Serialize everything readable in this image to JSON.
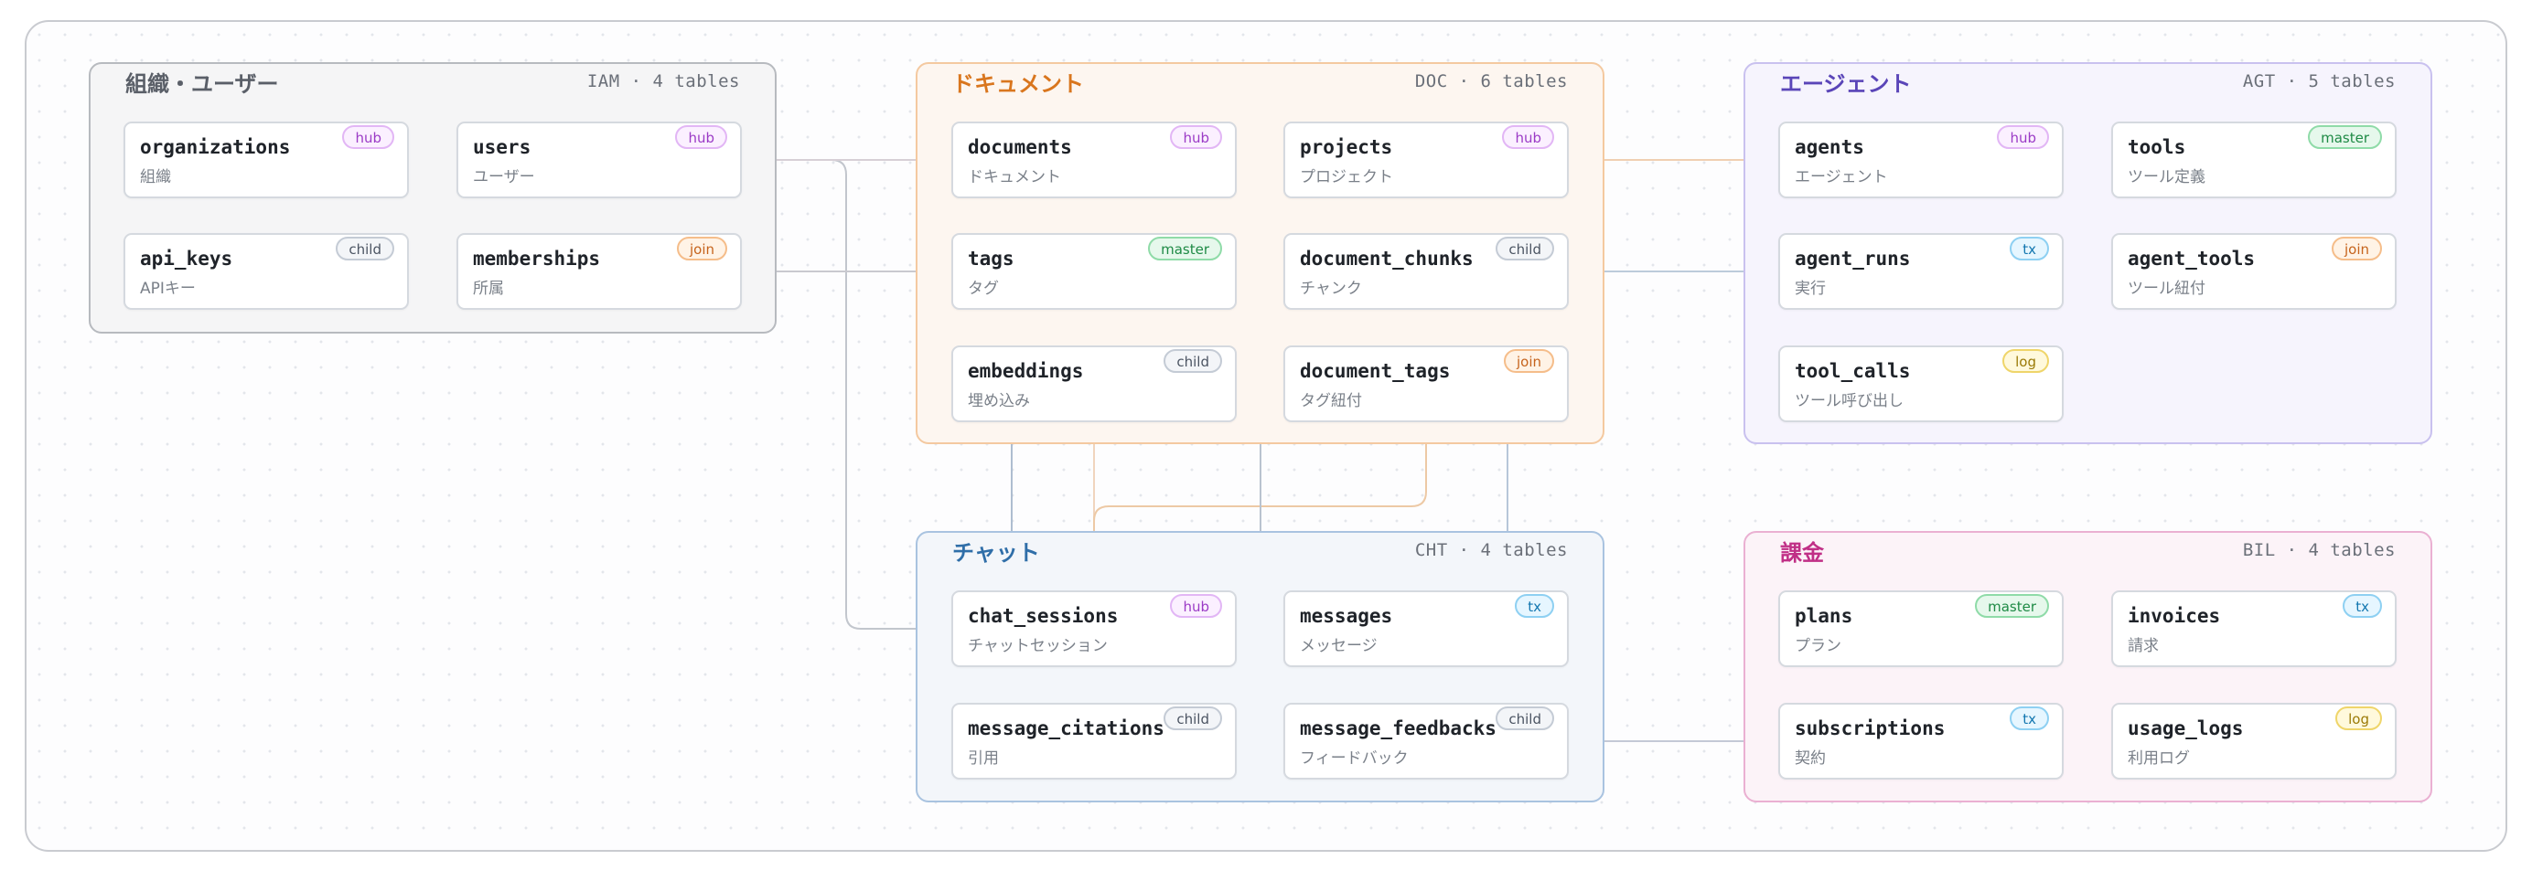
{
  "groups": [
    {
      "id": "iam",
      "title": "組織・ユーザー",
      "meta": "IAM · 4 tables",
      "color": "#5a5f68",
      "border": "#b7babf",
      "bg": "#f5f5f6"
    },
    {
      "id": "doc",
      "title": "ドキュメント",
      "meta": "DOC · 6 tables",
      "color": "#d9761e",
      "border": "#f4c9a0",
      "bg": "#fdf6f0"
    },
    {
      "id": "agt",
      "title": "エージェント",
      "meta": "AGT · 5 tables",
      "color": "#5a45b8",
      "border": "#c9c1ef",
      "bg": "#f6f4fd"
    },
    {
      "id": "cht",
      "title": "チャット",
      "meta": "CHT · 4 tables",
      "color": "#2f6ea8",
      "border": "#a9c3e0",
      "bg": "#f3f6fa"
    },
    {
      "id": "bil",
      "title": "課金",
      "meta": "BIL · 4 tables",
      "color": "#c02f86",
      "border": "#eab0d2",
      "bg": "#fcf3f8"
    }
  ],
  "tables": [
    {
      "id": "organizations",
      "name": "organizations",
      "sub": "組織",
      "badge": "hub"
    },
    {
      "id": "users",
      "name": "users",
      "sub": "ユーザー",
      "badge": "hub"
    },
    {
      "id": "api_keys",
      "name": "api_keys",
      "sub": "APIキー",
      "badge": "child"
    },
    {
      "id": "memberships",
      "name": "memberships",
      "sub": "所属",
      "badge": "join"
    },
    {
      "id": "documents",
      "name": "documents",
      "sub": "ドキュメント",
      "badge": "hub"
    },
    {
      "id": "projects",
      "name": "projects",
      "sub": "プロジェクト",
      "badge": "hub"
    },
    {
      "id": "tags",
      "name": "tags",
      "sub": "タグ",
      "badge": "master"
    },
    {
      "id": "document_chunks",
      "name": "document_chunks",
      "sub": "チャンク",
      "badge": "child"
    },
    {
      "id": "embeddings",
      "name": "embeddings",
      "sub": "埋め込み",
      "badge": "child"
    },
    {
      "id": "document_tags",
      "name": "document_tags",
      "sub": "タグ紐付",
      "badge": "join"
    },
    {
      "id": "agents",
      "name": "agents",
      "sub": "エージェント",
      "badge": "hub"
    },
    {
      "id": "tools",
      "name": "tools",
      "sub": "ツール定義",
      "badge": "master"
    },
    {
      "id": "agent_runs",
      "name": "agent_runs",
      "sub": "実行",
      "badge": "tx"
    },
    {
      "id": "agent_tools",
      "name": "agent_tools",
      "sub": "ツール紐付",
      "badge": "join"
    },
    {
      "id": "tool_calls",
      "name": "tool_calls",
      "sub": "ツール呼び出し",
      "badge": "log"
    },
    {
      "id": "chat_sessions",
      "name": "chat_sessions",
      "sub": "チャットセッション",
      "badge": "hub"
    },
    {
      "id": "messages",
      "name": "messages",
      "sub": "メッセージ",
      "badge": "tx"
    },
    {
      "id": "message_citations",
      "name": "message_citations",
      "sub": "引用",
      "badge": "child"
    },
    {
      "id": "message_feedbacks",
      "name": "message_feedbacks",
      "sub": "フィードバック",
      "badge": "child"
    },
    {
      "id": "plans",
      "name": "plans",
      "sub": "プラン",
      "badge": "master"
    },
    {
      "id": "invoices",
      "name": "invoices",
      "sub": "請求",
      "badge": "tx"
    },
    {
      "id": "subscriptions",
      "name": "subscriptions",
      "sub": "契約",
      "badge": "tx"
    },
    {
      "id": "usage_logs",
      "name": "usage_logs",
      "sub": "利用ログ",
      "badge": "log"
    }
  ]
}
